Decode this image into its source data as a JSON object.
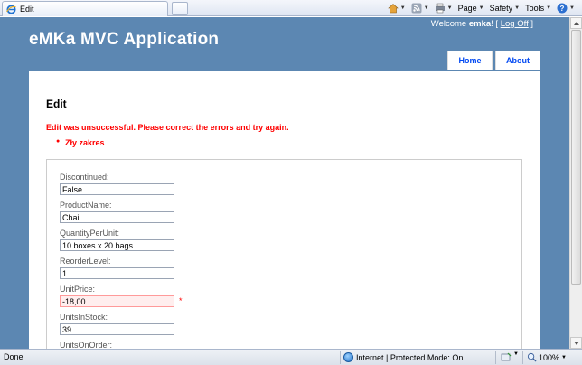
{
  "browser": {
    "tab_title": "Edit",
    "tools": {
      "page": "Page",
      "safety": "Safety",
      "tools": "Tools"
    }
  },
  "site": {
    "title": "eMKa MVC Application",
    "welcome": "Welcome ",
    "user": "emka",
    "login_open": "! [ ",
    "logoff": "Log Off",
    "login_close": " ]",
    "menu": [
      {
        "label": "Home"
      },
      {
        "label": "About"
      }
    ]
  },
  "page": {
    "title": "Edit",
    "validation_summary": "Edit was unsuccessful. Please correct the errors and try again.",
    "validation_errors": [
      "Zły zakres"
    ],
    "fields": [
      {
        "label": "Discontinued:",
        "value": "False",
        "error": false
      },
      {
        "label": "ProductName:",
        "value": "Chai",
        "error": false
      },
      {
        "label": "QuantityPerUnit:",
        "value": "10 boxes x 20 bags",
        "error": false
      },
      {
        "label": "ReorderLevel:",
        "value": "1",
        "error": false
      },
      {
        "label": "UnitPrice:",
        "value": "-18,00",
        "error": true,
        "marker": "*"
      },
      {
        "label": "UnitsInStock:",
        "value": "39",
        "error": false
      },
      {
        "label": "UnitsOnOrder:",
        "value": "",
        "error": false
      }
    ]
  },
  "status": {
    "text": "Done",
    "zone": "Internet | Protected Mode: On",
    "zoom": "100%"
  }
}
